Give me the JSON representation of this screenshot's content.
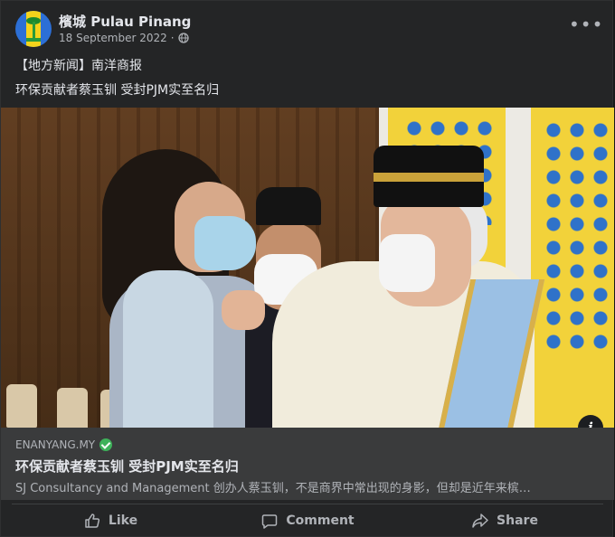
{
  "post": {
    "page_name": "檳城 Pulau Pinang",
    "date": "18 September 2022",
    "separator": "·",
    "privacy_icon": "globe-icon",
    "more_label": "•••",
    "text_line1": "【地方新闻】南洋商报",
    "text_line2": "环保贡献者蔡玉钏 受封PJM实至名归"
  },
  "photo": {
    "info_label": "i",
    "description": "Photo"
  },
  "link_preview": {
    "domain": "ENANYANG.MY",
    "title": "环保贡献者蔡玉钏 受封PJM实至名归",
    "description": "SJ Consultancy and Management 创办人蔡玉钏，不是商界中常出现的身影，但却是近年来槟…"
  },
  "actions": [
    {
      "label": "Like",
      "icon": "like-icon"
    },
    {
      "label": "Comment",
      "icon": "comment-icon"
    },
    {
      "label": "Share",
      "icon": "share-icon"
    }
  ],
  "colors": {
    "background": "#242526",
    "preview_background": "#3a3b3c",
    "text_primary": "#e4e6eb",
    "text_secondary": "#b0b3b8",
    "verified": "#3eb15a"
  }
}
